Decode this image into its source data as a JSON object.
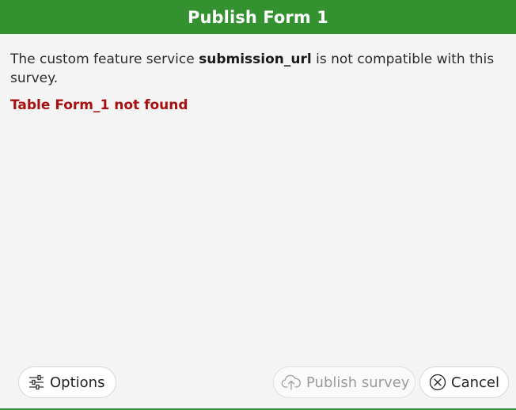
{
  "dialog": {
    "title": "Publish Form 1"
  },
  "message": {
    "prefix": "The custom feature service ",
    "service_name": "submission_url",
    "suffix": " is not compatible with this survey."
  },
  "error": {
    "text": "Table Form_1 not found",
    "color": "#a80f0f"
  },
  "buttons": {
    "options_label": "Options",
    "options_icon": "sliders-icon",
    "publish_label": "Publish survey",
    "publish_icon": "cloud-upload-icon",
    "publish_enabled": false,
    "cancel_label": "Cancel",
    "cancel_icon": "close-circle-icon"
  },
  "colors": {
    "header_green": "#33912f"
  }
}
